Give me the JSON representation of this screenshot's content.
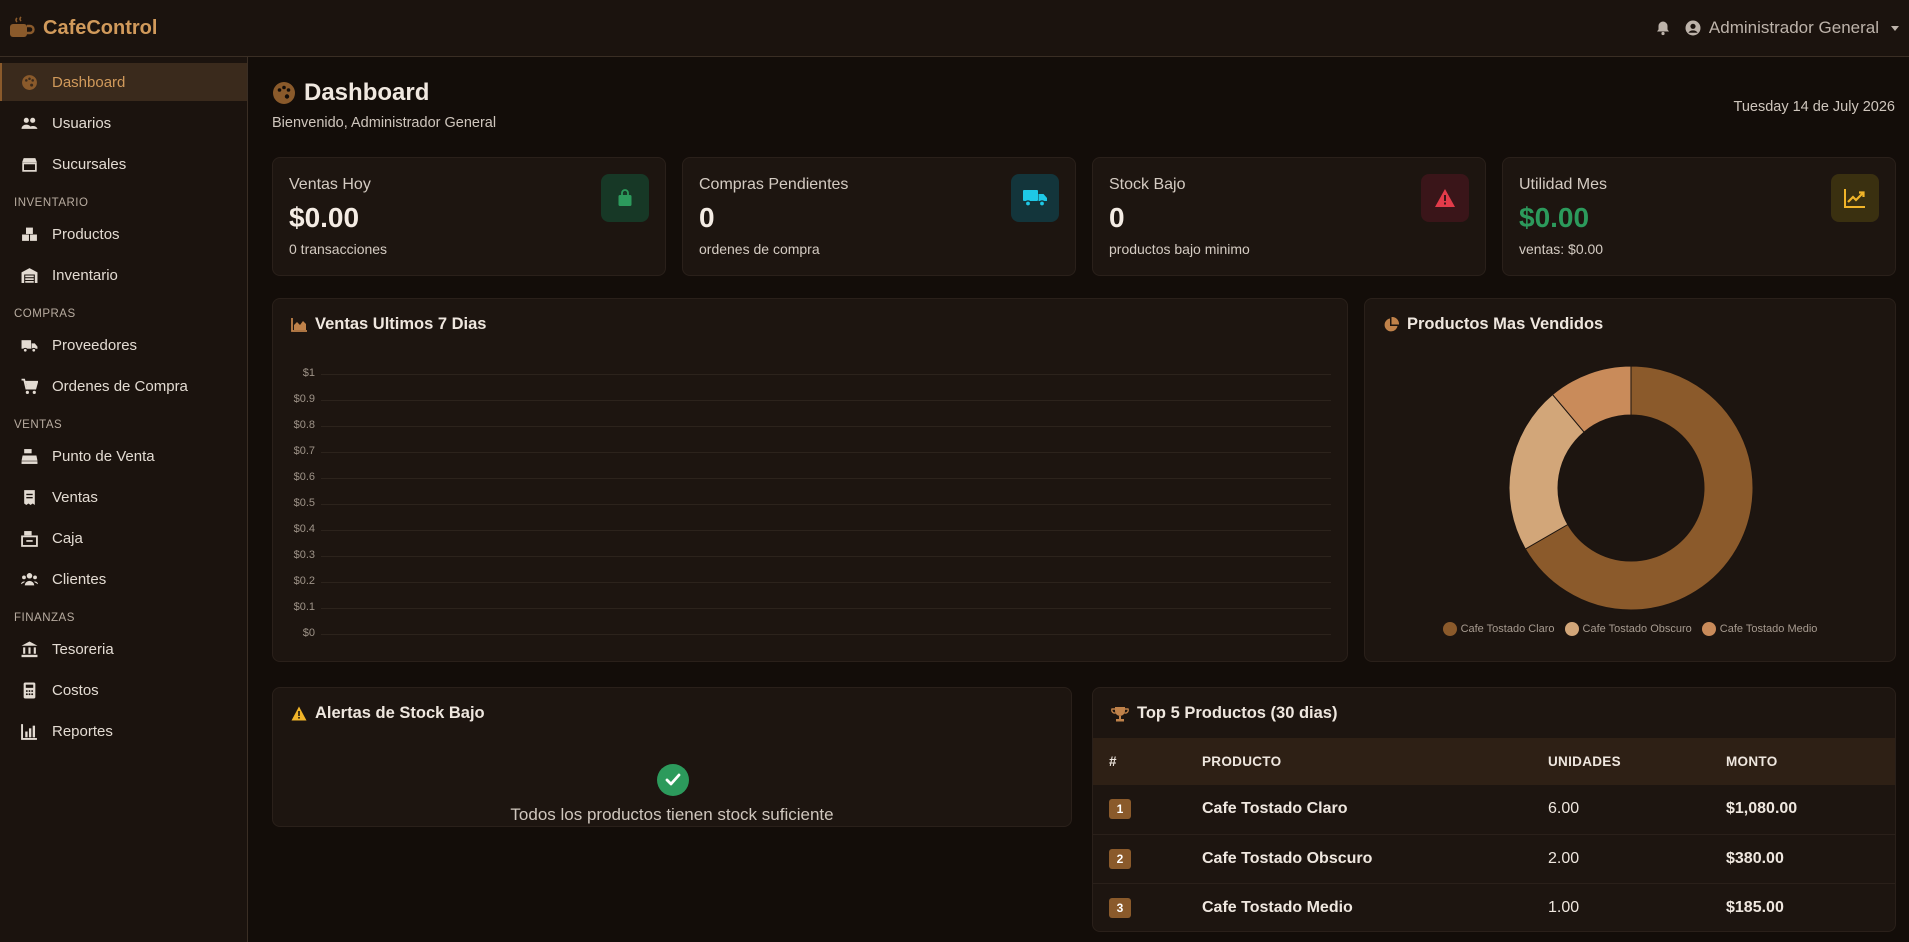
{
  "app": {
    "brand": "CafeControl",
    "user_name": "Administrador General"
  },
  "sidebar": {
    "items": [
      {
        "label": "Dashboard",
        "icon": "palette-icon"
      },
      {
        "label": "Usuarios",
        "icon": "users-icon"
      },
      {
        "label": "Sucursales",
        "icon": "store-icon"
      }
    ],
    "sections": [
      {
        "title": "INVENTARIO",
        "items": [
          {
            "label": "Productos",
            "icon": "boxes-icon"
          },
          {
            "label": "Inventario",
            "icon": "warehouse-icon"
          }
        ]
      },
      {
        "title": "COMPRAS",
        "items": [
          {
            "label": "Proveedores",
            "icon": "truck-icon"
          },
          {
            "label": "Ordenes de Compra",
            "icon": "cart-icon"
          }
        ]
      },
      {
        "title": "VENTAS",
        "items": [
          {
            "label": "Punto de Venta",
            "icon": "cash-register-icon"
          },
          {
            "label": "Ventas",
            "icon": "receipt-icon"
          },
          {
            "label": "Caja",
            "icon": "cash-box-icon"
          },
          {
            "label": "Clientes",
            "icon": "clients-icon"
          }
        ]
      },
      {
        "title": "FINANZAS",
        "items": [
          {
            "label": "Tesoreria",
            "icon": "bank-icon"
          },
          {
            "label": "Costos",
            "icon": "calculator-icon"
          },
          {
            "label": "Reportes",
            "icon": "chart-icon"
          }
        ]
      }
    ]
  },
  "header": {
    "title": "Dashboard",
    "welcome": "Bienvenido, Administrador General",
    "date": "Tuesday 14 de July 2026"
  },
  "stats": [
    {
      "label": "Ventas Hoy",
      "value": "$0.00",
      "sub": "0 transacciones",
      "icon": "shopping-bag-icon",
      "color": "#2c9a5c"
    },
    {
      "label": "Compras Pendientes",
      "value": "0",
      "sub": "ordenes de compra",
      "icon": "truck-icon",
      "color": "#1ec8e6"
    },
    {
      "label": "Stock Bajo",
      "value": "0",
      "sub": "productos bajo minimo",
      "icon": "warning-icon",
      "color": "#e23b4a"
    },
    {
      "label": "Utilidad Mes",
      "value": "$0.00",
      "sub": "ventas: $0.00",
      "icon": "trend-icon",
      "color": "#f0b429"
    }
  ],
  "sales_chart": {
    "title": "Ventas Ultimos 7 Dias"
  },
  "products_chart": {
    "title": "Productos Mas Vendidos"
  },
  "chart_data": [
    {
      "type": "line",
      "title": "Ventas Ultimos 7 Dias",
      "yticks": [
        "$0",
        "$0.1",
        "$0.2",
        "$0.3",
        "$0.4",
        "$0.5",
        "$0.6",
        "$0.7",
        "$0.8",
        "$0.9",
        "$1"
      ],
      "ylim": [
        0,
        1
      ],
      "grid": true,
      "series": []
    },
    {
      "type": "pie",
      "title": "Productos Mas Vendidos",
      "categories": [
        "Cafe Tostado Claro",
        "Cafe Tostado Obscuro",
        "Cafe Tostado Medio"
      ],
      "values": [
        6,
        2,
        1
      ],
      "colors": [
        "#8b5a2b",
        "#d2a679",
        "#c98b5a"
      ],
      "legend": "bottom"
    }
  ],
  "alerts": {
    "title": "Alertas de Stock Bajo",
    "message": "Todos los productos tienen stock suficiente"
  },
  "top_products": {
    "title": "Top 5 Productos (30 dias)",
    "columns": [
      "#",
      "PRODUCTO",
      "UNIDADES",
      "MONTO"
    ],
    "rows": [
      {
        "rank": "1",
        "product": "Cafe Tostado Claro",
        "units": "6.00",
        "amount": "$1,080.00"
      },
      {
        "rank": "2",
        "product": "Cafe Tostado Obscuro",
        "units": "2.00",
        "amount": "$380.00"
      },
      {
        "rank": "3",
        "product": "Cafe Tostado Medio",
        "units": "1.00",
        "amount": "$185.00"
      }
    ]
  }
}
